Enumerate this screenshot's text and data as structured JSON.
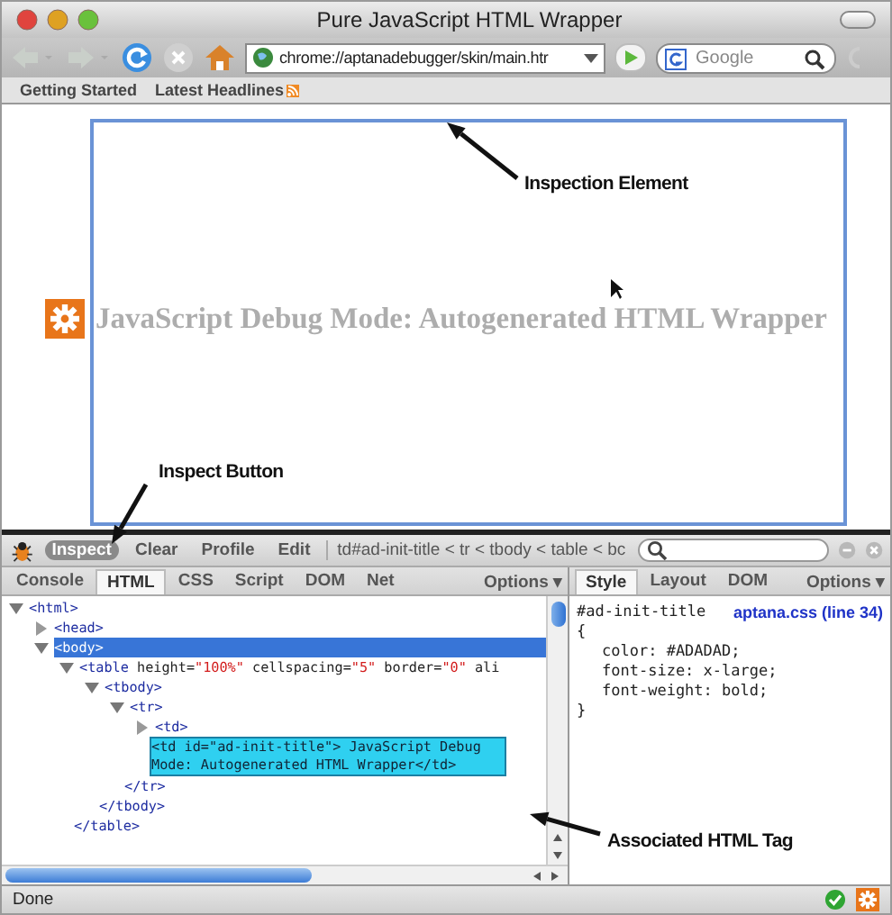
{
  "window": {
    "title": "Pure JavaScript HTML Wrapper"
  },
  "toolbar": {
    "url": "chrome://aptanadebugger/skin/main.htr",
    "search": {
      "placeholder": "Google"
    }
  },
  "bookmarks": [
    {
      "label": "Getting Started",
      "kind": "link"
    },
    {
      "label": "Latest Headlines",
      "kind": "feed"
    }
  ],
  "page": {
    "heading": "JavaScript Debug Mode: Autogenerated HTML Wrapper"
  },
  "annotations": [
    {
      "text": "Inspection Element",
      "kind": "inspection-element"
    },
    {
      "text": "Inspect Button",
      "kind": "inspect-button"
    },
    {
      "text": "Associated HTML Tag",
      "kind": "html-tag"
    }
  ],
  "firebug": {
    "buttons": [
      {
        "label": "Inspect",
        "selected": true
      },
      {
        "label": "Clear",
        "selected": false
      },
      {
        "label": "Profile",
        "selected": false
      },
      {
        "label": "Edit",
        "selected": false
      }
    ],
    "breadcrumb": "td#ad-init-title < tr < tbody < table < bc",
    "tabs": [
      {
        "label": "Console",
        "selected": false
      },
      {
        "label": "HTML",
        "selected": true
      },
      {
        "label": "CSS",
        "selected": false
      },
      {
        "label": "Script",
        "selected": false
      },
      {
        "label": "DOM",
        "selected": false
      },
      {
        "label": "Net",
        "selected": false
      }
    ],
    "options": "Options ▾",
    "tree": [
      {
        "kind": "element",
        "tokens": [
          {
            "kind": "tag",
            "text": "<html>"
          }
        ],
        "expanded": true,
        "selected": false,
        "children": [
          {
            "kind": "element",
            "tokens": [
              {
                "kind": "tag",
                "text": "<head>"
              }
            ],
            "expanded": false,
            "selected": false
          },
          {
            "kind": "element",
            "tokens": [
              {
                "kind": "tag",
                "text": "<body>"
              }
            ],
            "expanded": true,
            "selected": true,
            "children": [
              {
                "kind": "element",
                "tokens": [
                  {
                    "kind": "tag",
                    "text": "<table"
                  },
                  {
                    "kind": "attr",
                    "text": " height="
                  },
                  {
                    "kind": "value",
                    "text": "\"100%\""
                  },
                  {
                    "kind": "attr",
                    "text": " cellspacing="
                  },
                  {
                    "kind": "value",
                    "text": "\"5\""
                  },
                  {
                    "kind": "attr",
                    "text": " border="
                  },
                  {
                    "kind": "value",
                    "text": "\"0\""
                  },
                  {
                    "kind": "attr",
                    "text": " ali"
                  }
                ],
                "expanded": true,
                "selected": false,
                "close": "</table>",
                "children": [
                  {
                    "kind": "element",
                    "tokens": [
                      {
                        "kind": "tag",
                        "text": "<tbody>"
                      }
                    ],
                    "expanded": true,
                    "selected": false,
                    "close": "</tbody>",
                    "children": [
                      {
                        "kind": "element",
                        "tokens": [
                          {
                            "kind": "tag",
                            "text": "<tr>"
                          }
                        ],
                        "expanded": true,
                        "selected": false,
                        "close": "</tr>",
                        "children": [
                          {
                            "kind": "element",
                            "tokens": [
                              {
                                "kind": "tag",
                                "text": "<td>"
                              }
                            ],
                            "expanded": false,
                            "selected": false
                          },
                          {
                            "kind": "inspected",
                            "tokens": [
                              {
                                "kind": "tag",
                                "text": "<td"
                              },
                              {
                                "kind": "attr",
                                "text": " id="
                              },
                              {
                                "kind": "value",
                                "text": "\"ad-init-title\""
                              },
                              {
                                "kind": "tag",
                                "text": ">"
                              },
                              {
                                "kind": "text",
                                "text": " JavaScript Debug Mode: Autogenerated HTML Wrapper"
                              },
                              {
                                "kind": "tag",
                                "text": "</td>"
                              }
                            ],
                            "selected": false
                          }
                        ]
                      }
                    ]
                  }
                ]
              }
            ]
          }
        ]
      }
    ],
    "side_tabs": [
      {
        "label": "Style",
        "selected": true
      },
      {
        "label": "Layout",
        "selected": false
      },
      {
        "label": "DOM",
        "selected": false
      }
    ],
    "side_options": "Options ▾",
    "style": {
      "selector": "#ad-init-title",
      "source": "aptana.css (line 34)",
      "open": "{",
      "properties": [
        "color: #ADADAD;",
        "font-size: x-large;",
        "font-weight: bold;"
      ],
      "close": "}"
    }
  },
  "status_bar": {
    "text": "Done"
  }
}
